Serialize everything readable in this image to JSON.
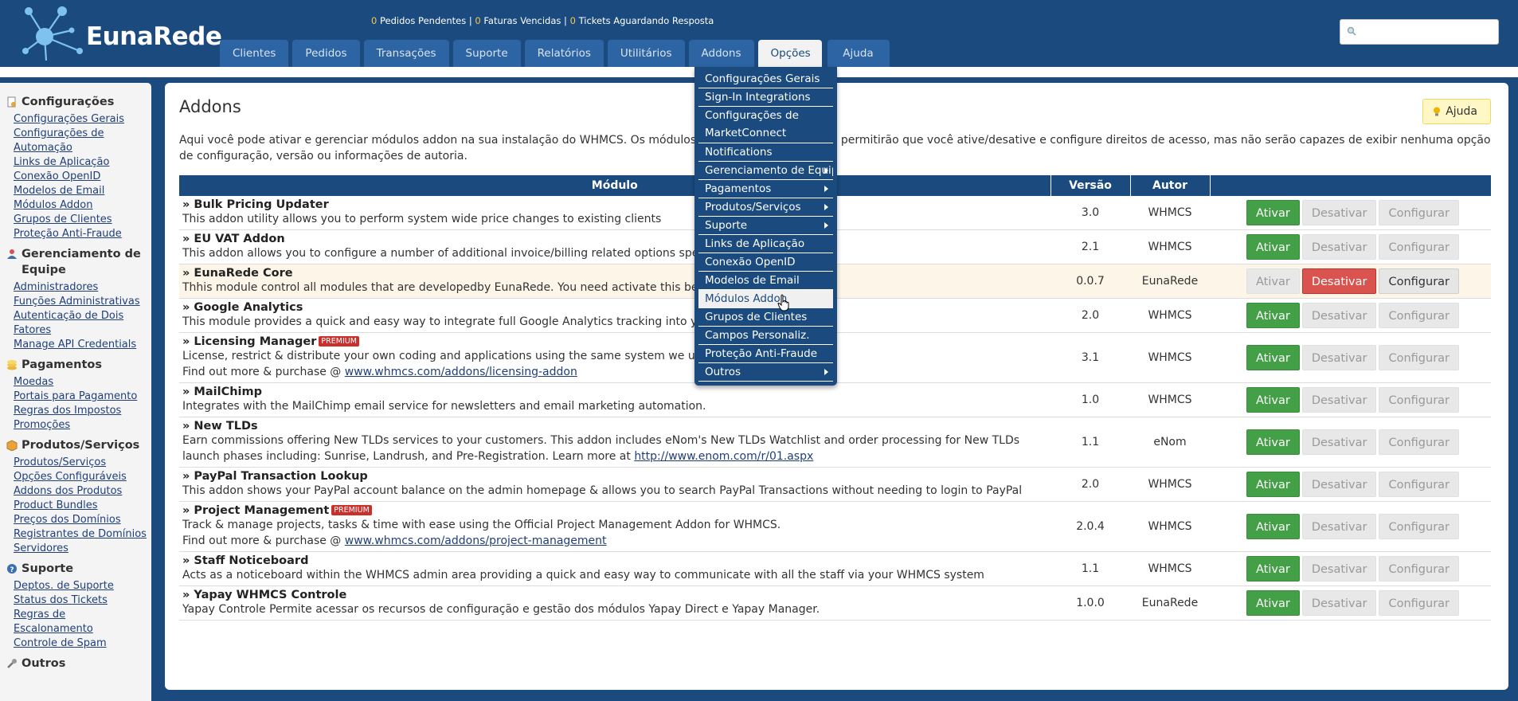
{
  "header": {
    "brand": "EunaRede",
    "stats": [
      {
        "count": "0",
        "label": " Pedidos Pendentes"
      },
      {
        "count": "0",
        "label": " Faturas Vencidas"
      },
      {
        "count": "0",
        "label": " Tickets Aguardando Resposta"
      }
    ],
    "stat_sep": " | ",
    "tabs": [
      "Clientes",
      "Pedidos",
      "Transações",
      "Suporte",
      "Relatórios",
      "Utilitários",
      "Addons",
      "Opções",
      "Ajuda"
    ],
    "active_tab": "Opções",
    "search_value": ""
  },
  "sidebar": {
    "sections": [
      {
        "title": "Configurações",
        "icon": "document-gear-icon",
        "links": [
          "Configurações Gerais",
          "Configurações de Automação",
          "Links de Aplicação",
          "Conexão OpenID",
          "Modelos de Email",
          "Módulos Addon",
          "Grupos de Clientes",
          "Proteção Anti-Fraude"
        ]
      },
      {
        "title": "Gerenciamento de Equipe",
        "icon": "user-icon",
        "links": [
          "Administradores",
          "Funções Administrativas",
          "Autenticação de Dois Fatores",
          "Manage API Credentials"
        ]
      },
      {
        "title": "Pagamentos",
        "icon": "coins-icon",
        "links": [
          "Moedas",
          "Portais para Pagamento",
          "Regras dos Impostos",
          "Promoções"
        ]
      },
      {
        "title": "Produtos/Serviços",
        "icon": "box-icon",
        "links": [
          "Produtos/Serviços",
          "Opções Configuráveis",
          "Addons dos Produtos",
          "Product Bundles",
          "Preços dos Domínios",
          "Registrantes de Domínios",
          "Servidores"
        ]
      },
      {
        "title": "Suporte",
        "icon": "help-circle-icon",
        "links": [
          "Deptos. de Suporte",
          "Status dos Tickets",
          "Regras de Escalonamento",
          "Controle de Spam"
        ]
      },
      {
        "title": "Outros",
        "icon": "wrench-icon",
        "links": []
      }
    ]
  },
  "page": {
    "title": "Addons",
    "help_label": "Ajuda",
    "intro": "Aqui você pode ativar e gerenciar módulos addon na sua instalação do WHMCS. Os módulos her[...]permitirão que você ative/desative e configure direitos de acesso, mas não serão capazes de exibir nenhuma opção de configuração, versão ou informações de autoria.",
    "intro_a": "Aqui você pode ativar e gerenciar módulos addon na sua instalação do WHMCS. Os módulos her",
    "intro_b": "permitirão que você ative/desative e configure direitos de acesso, mas não serão capazes de exibir nenhuma opção de configuração, versão ou informações de autoria."
  },
  "table": {
    "headers": {
      "module": "Módulo",
      "version": "Versão",
      "author": "Autor"
    },
    "buttons": {
      "activate": "Ativar",
      "deactivate": "Desativar",
      "configure": "Configurar"
    },
    "premium_label": "PREMIUM",
    "rows": [
      {
        "name": "» Bulk Pricing Updater",
        "premium": false,
        "desc": "This addon utility allows you to perform system wide price changes to existing clients",
        "link": "",
        "version": "3.0",
        "author": "WHMCS",
        "active": false
      },
      {
        "name": "» EU VAT Addon",
        "premium": false,
        "desc": "This addon allows you to configure a number of additional invoice/billing related options specifi                                                quirements",
        "link": "",
        "version": "2.1",
        "author": "WHMCS",
        "active": false
      },
      {
        "name": "» EunaRede Core",
        "premium": false,
        "desc": "Thhis module control all modules that are developedby EunaRede. You need activate this before",
        "link": "",
        "version": "0.0.7",
        "author": "EunaRede",
        "active": true
      },
      {
        "name": "» Google Analytics",
        "premium": false,
        "desc": "This module provides a quick and easy way to integrate full Google Analytics tracking into your w",
        "link": "",
        "version": "2.0",
        "author": "WHMCS",
        "active": false
      },
      {
        "name": "» Licensing Manager",
        "premium": true,
        "desc": "License, restrict & distribute your own coding and applications using the same system we use fo",
        "link_prefix": "Find out more & purchase @ ",
        "link": "www.whmcs.com/addons/licensing-addon",
        "version": "3.1",
        "author": "WHMCS",
        "active": false
      },
      {
        "name": "» MailChimp",
        "premium": false,
        "desc": "Integrates with the MailChimp email service for newsletters and email marketing automation.",
        "link": "",
        "version": "1.0",
        "author": "WHMCS",
        "active": false
      },
      {
        "name": "» New TLDs",
        "premium": false,
        "desc": "Earn commissions offering New TLDs services to your customers. This addon includes eNom's New TLDs Watchlist and order processing for New TLDs launch phases including: Sunrise, Landrush, and Pre-Registration. Learn more at ",
        "link": "http://www.enom.com/r/01.aspx",
        "inline_link": true,
        "version": "1.1",
        "author": "eNom",
        "active": false
      },
      {
        "name": "» PayPal Transaction Lookup",
        "premium": false,
        "desc": "This addon shows your PayPal account balance on the admin homepage & allows you to search PayPal Transactions without needing to login to PayPal",
        "link": "",
        "version": "2.0",
        "author": "WHMCS",
        "active": false
      },
      {
        "name": "» Project Management",
        "premium": true,
        "desc": "Track & manage projects, tasks & time with ease using the Official Project Management Addon for WHMCS.",
        "link_prefix": "Find out more & purchase @ ",
        "link": "www.whmcs.com/addons/project-management",
        "version": "2.0.4",
        "author": "WHMCS",
        "active": false
      },
      {
        "name": "» Staff Noticeboard",
        "premium": false,
        "desc": "Acts as a noticeboard within the WHMCS admin area providing a quick and easy way to communicate with all the staff via your WHMCS system",
        "link": "",
        "version": "1.1",
        "author": "WHMCS",
        "active": false
      },
      {
        "name": "» Yapay WHMCS Controle",
        "premium": false,
        "desc": "Yapay Controle Permite acessar os recursos de configuração e gestão dos módulos Yapay Direct e Yapay Manager.",
        "link": "",
        "version": "1.0.0",
        "author": "EunaRede",
        "active": false
      }
    ]
  },
  "dropdown": {
    "items": [
      {
        "label": "Configurações Gerais",
        "submenu": false
      },
      {
        "label": "Sign-In Integrations",
        "submenu": false
      },
      {
        "label": "Configurações de MarketConnect",
        "submenu": false,
        "wrap": true
      },
      {
        "label": "Notifications",
        "submenu": false
      },
      {
        "label": "Gerenciamento de Equipe",
        "submenu": true
      },
      {
        "label": "Pagamentos",
        "submenu": true
      },
      {
        "label": "Produtos/Serviços",
        "submenu": true
      },
      {
        "label": "Suporte",
        "submenu": true
      },
      {
        "label": "Links de Aplicação",
        "submenu": false
      },
      {
        "label": "Conexão OpenID",
        "submenu": false
      },
      {
        "label": "Modelos de Email",
        "submenu": false
      },
      {
        "label": "Módulos Addon",
        "submenu": false,
        "selected": true
      },
      {
        "label": "Grupos de Clientes",
        "submenu": false
      },
      {
        "label": "Campos Personaliz.",
        "submenu": false
      },
      {
        "label": "Proteção Anti-Fraude",
        "submenu": false
      },
      {
        "label": "Outros",
        "submenu": true
      }
    ]
  },
  "colors": {
    "header": "#1a4a7e",
    "tab": "#2d64a3",
    "activate": "#43a047",
    "deactivate_active": "#d9534f",
    "highlight_row": "#fdf6e8",
    "stat_count": "#f7c948"
  }
}
